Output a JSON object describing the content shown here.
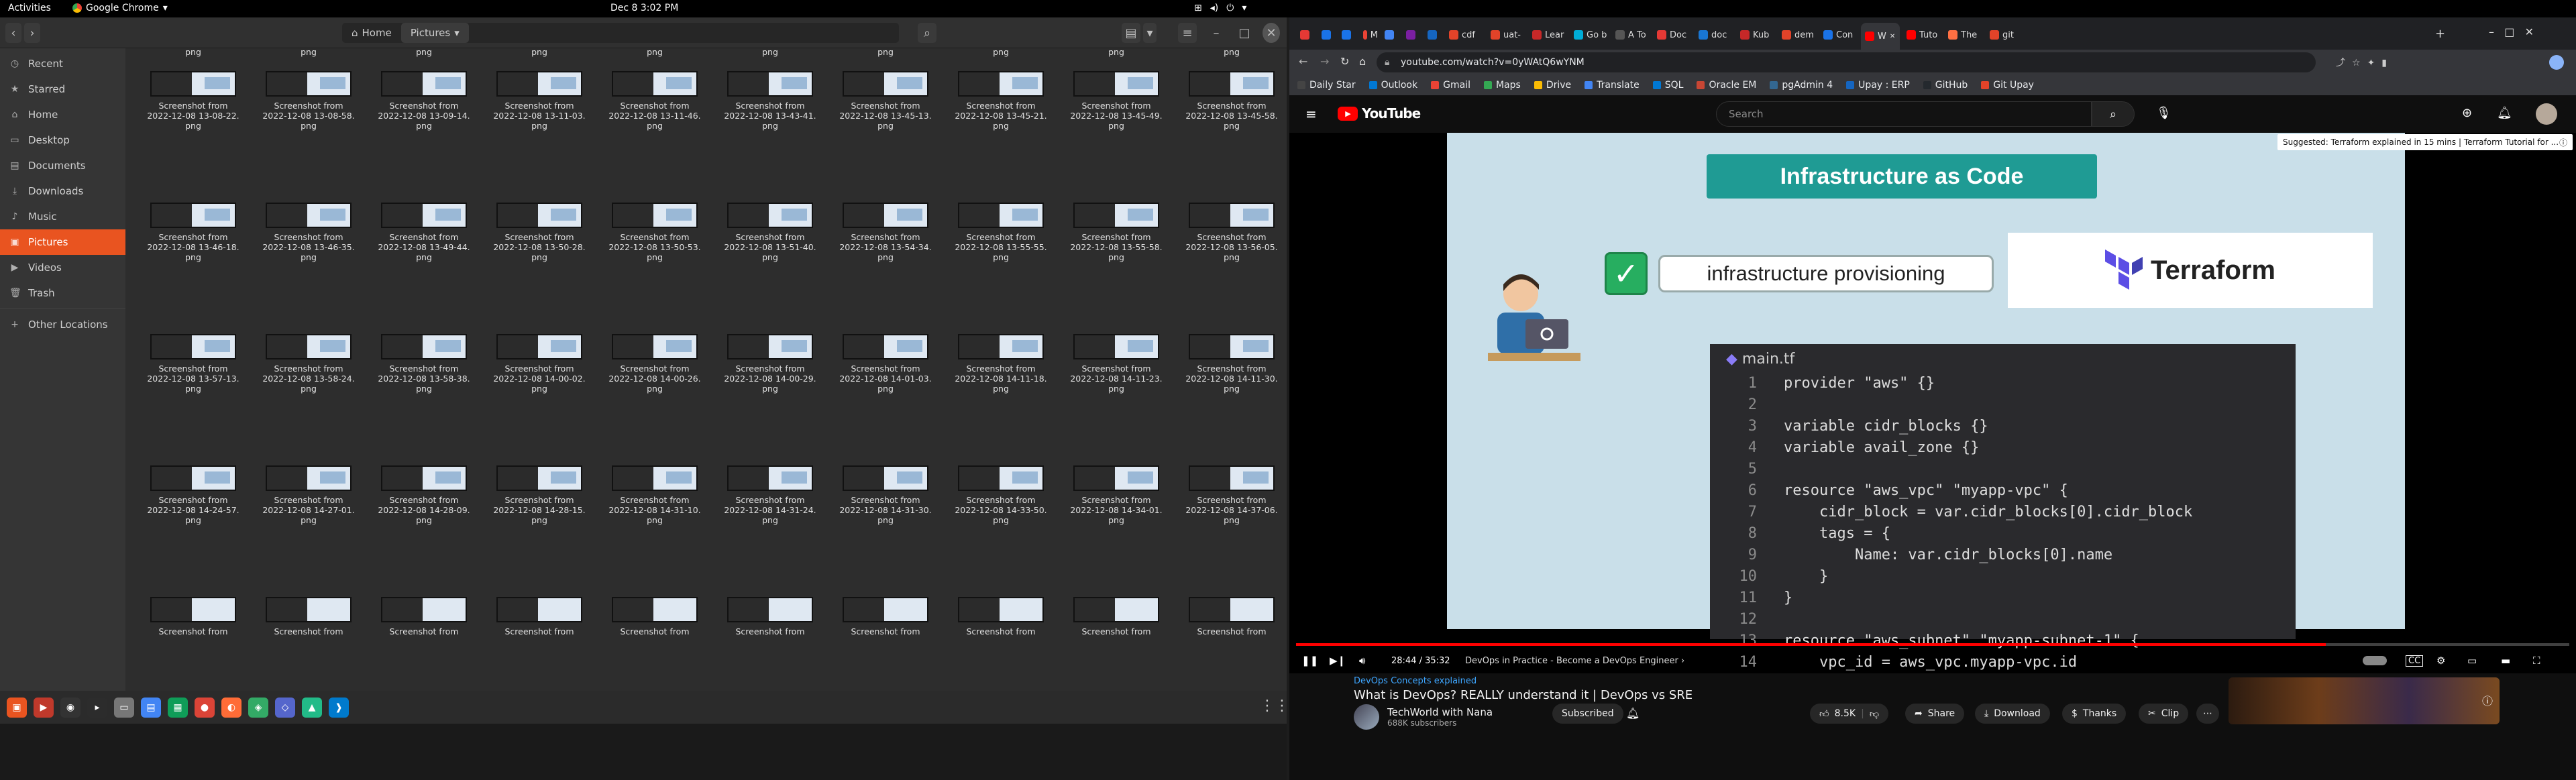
{
  "topbar": {
    "activities": "Activities",
    "app": "Google Chrome",
    "clock": "Dec 8  3:02 PM"
  },
  "nautilus": {
    "path": {
      "home": "Home",
      "current": "Pictures"
    },
    "sidebar": [
      {
        "label": "Recent",
        "icon": "clock-icon"
      },
      {
        "label": "Starred",
        "icon": "star-icon"
      },
      {
        "label": "Home",
        "icon": "home-icon"
      },
      {
        "label": "Desktop",
        "icon": "desktop-icon"
      },
      {
        "label": "Documents",
        "icon": "document-icon"
      },
      {
        "label": "Downloads",
        "icon": "download-icon"
      },
      {
        "label": "Music",
        "icon": "music-icon"
      },
      {
        "label": "Pictures",
        "icon": "picture-icon",
        "selected": true
      },
      {
        "label": "Videos",
        "icon": "video-icon"
      },
      {
        "label": "Trash",
        "icon": "trash-icon"
      },
      {
        "label": "Other Locations",
        "icon": "plus-icon"
      }
    ],
    "file_prefix": "Screenshot from",
    "file_ext": "png",
    "rows": [
      [
        "2022-12-08 13-08-22.",
        "2022-12-08 13-08-58.",
        "2022-12-08 13-09-14.",
        "2022-12-08 13-11-03.",
        "2022-12-08 13-11-46.",
        "2022-12-08 13-43-41.",
        "2022-12-08 13-45-13.",
        "2022-12-08 13-45-21.",
        "2022-12-08 13-45-49.",
        "2022-12-08 13-45-58."
      ],
      [
        "2022-12-08 13-46-18.",
        "2022-12-08 13-46-35.",
        "2022-12-08 13-49-44.",
        "2022-12-08 13-50-28.",
        "2022-12-08 13-50-53.",
        "2022-12-08 13-51-40.",
        "2022-12-08 13-54-34.",
        "2022-12-08 13-55-55.",
        "2022-12-08 13-55-58.",
        "2022-12-08 13-56-05."
      ],
      [
        "2022-12-08 13-57-13.",
        "2022-12-08 13-58-24.",
        "2022-12-08 13-58-38.",
        "2022-12-08 14-00-02.",
        "2022-12-08 14-00-26.",
        "2022-12-08 14-00-29.",
        "2022-12-08 14-01-03.",
        "2022-12-08 14-11-18.",
        "2022-12-08 14-11-23.",
        "2022-12-08 14-11-30."
      ],
      [
        "2022-12-08 14-24-57.",
        "2022-12-08 14-27-01.",
        "2022-12-08 14-28-09.",
        "2022-12-08 14-28-15.",
        "2022-12-08 14-31-10.",
        "2022-12-08 14-31-24.",
        "2022-12-08 14-31-30.",
        "2022-12-08 14-33-50.",
        "2022-12-08 14-34-01.",
        "2022-12-08 14-37-06."
      ]
    ]
  },
  "chrome": {
    "tabs": [
      {
        "label": "",
        "color": "#e53935"
      },
      {
        "label": "",
        "color": "#1a73e8"
      },
      {
        "label": "",
        "color": "#1a73e8"
      },
      {
        "label": "M",
        "color": "#ea4335"
      },
      {
        "label": "",
        "color": "#4285f4"
      },
      {
        "label": "",
        "color": "#7b1fa2"
      },
      {
        "label": "",
        "color": "#1565c0"
      },
      {
        "label": "cdf",
        "color": "#e24329"
      },
      {
        "label": "uat-",
        "color": "#e24329"
      },
      {
        "label": "Lear",
        "color": "#c62828"
      },
      {
        "label": "Go b",
        "color": "#00acd7"
      },
      {
        "label": "A To",
        "color": "#555"
      },
      {
        "label": "Doc",
        "color": "#e53935"
      },
      {
        "label": "doc",
        "color": "#1976d2"
      },
      {
        "label": "Kub",
        "color": "#c62828"
      },
      {
        "label": "dem",
        "color": "#e24329"
      },
      {
        "label": "Con",
        "color": "#1a73e8"
      },
      {
        "label": "W",
        "color": "#ff0000",
        "active": true
      },
      {
        "label": "Tuto",
        "color": "#ff0000"
      },
      {
        "label": "The",
        "color": "#ff7043"
      },
      {
        "label": "git",
        "color": "#e24329"
      }
    ],
    "url": "youtube.com/watch?v=0yWAtQ6wYNM",
    "bookmarks": [
      {
        "label": "Daily Star",
        "color": "#444"
      },
      {
        "label": "Outlook",
        "color": "#0078d4"
      },
      {
        "label": "Gmail",
        "color": "#ea4335"
      },
      {
        "label": "Maps",
        "color": "#34a853"
      },
      {
        "label": "Drive",
        "color": "#fbbc04"
      },
      {
        "label": "Translate",
        "color": "#4285f4"
      },
      {
        "label": "SQL",
        "color": "#0078d4"
      },
      {
        "label": "Oracle EM",
        "color": "#c74634"
      },
      {
        "label": "pgAdmin 4",
        "color": "#336791"
      },
      {
        "label": "Upay : ERP",
        "color": "#1565c0"
      },
      {
        "label": "GitHub",
        "color": "#24292e"
      },
      {
        "label": "Git Upay",
        "color": "#e24329"
      }
    ]
  },
  "youtube": {
    "logo": "YouTube",
    "search_placeholder": "Search",
    "suggested": "Suggested: Terraform explained in 15 mins | Terraform Tutorial for ...",
    "slide": {
      "banner": "Infrastructure as Code",
      "provisioning": "infrastructure provisioning",
      "terraform": "Terraform",
      "filename": "main.tf",
      "code": [
        "provider \"aws\" {}",
        "",
        "variable cidr_blocks {}",
        "variable avail_zone {}",
        "",
        "resource \"aws_vpc\" \"myapp-vpc\" {",
        "    cidr_block = var.cidr_blocks[0].cidr_block",
        "    tags = {",
        "        Name: var.cidr_blocks[0].name",
        "    }",
        "}",
        "",
        "resource \"aws_subnet\" \"myapp-subnet-1\" {",
        "    vpc_id = aws_vpc.myapp-vpc.id"
      ]
    },
    "time": "28:44 / 35:32",
    "chapter": "DevOps in Practice - Become a DevOps Engineer",
    "progress": 0.809,
    "hashtag": "DevOps Concepts explained",
    "title": "What is DevOps? REALLY understand it | DevOps vs SRE",
    "channel": "TechWorld with Nana",
    "subscribers": "688K subscribers",
    "subscribed": "Subscribed",
    "likes": "8.5K",
    "share": "Share",
    "download": "Download",
    "thanks": "Thanks",
    "clip": "Clip"
  },
  "colors": {
    "ubuntu_orange": "#e95420",
    "yt_red": "#ff0000",
    "terraform_purple": "#5c4ee5"
  }
}
